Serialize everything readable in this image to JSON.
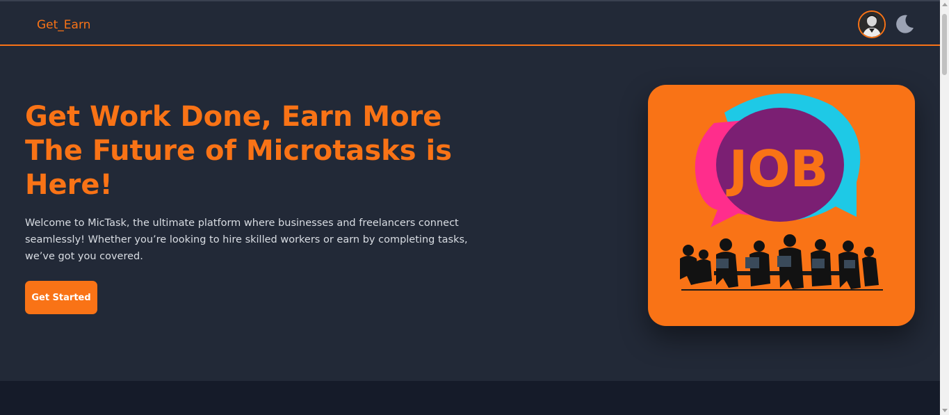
{
  "navbar": {
    "brand": "Get_Earn",
    "avatar_icon": "user-avatar",
    "theme_icon": "moon-icon"
  },
  "hero": {
    "title_lines": [
      "Get Work Done, Earn More",
      "The Future of Microtasks is",
      "Here!"
    ],
    "description": "Welcome to MicTask, the ultimate platform where businesses and freelancers connect seamlessly! Whether you’re looking to hire skilled workers or earn by completing tasks, we’ve got you covered.",
    "cta_label": "Get Started",
    "image_text": "JOB"
  },
  "colors": {
    "accent": "#f97316",
    "background": "#222937",
    "footer": "#151b29"
  }
}
